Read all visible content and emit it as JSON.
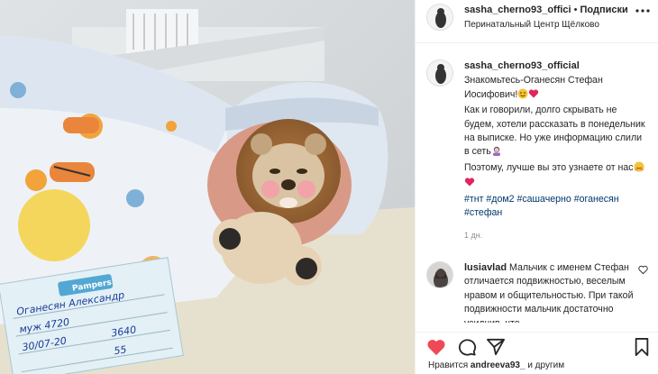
{
  "post": {
    "author": "sasha_cherno93_offici",
    "follow_label": "Подписки",
    "location": "Перинатальный Центр Щёлково",
    "separator": "•"
  },
  "caption": {
    "author": "sasha_cherno93_official",
    "line1": "Знакомьтесь-Оганесян Стефан Иосифович!",
    "line2": "Как и говорили, долго скрывать не будем, хотели рассказать в понедельник на выписке. Но уже информацию слили в сеть",
    "line3": "Поэтому, лучше вы это узнаете от нас",
    "hashtags": "#тнт #дом2 #сашачерно #оганесян #стефан",
    "timestamp": "1 дн."
  },
  "comment": {
    "author": "lusiavlad",
    "text": "Мальчик с именем Стефан отличается подвижностью, веселым нравом и общительностью. При такой подвижности мальчик достаточно усидчив, что"
  },
  "likes": {
    "prefix": "Нравится",
    "user": "andreeva93_",
    "suffix": "и другим"
  },
  "photo": {
    "card_lines": [
      "Pampers",
      "Оганесян Александр",
      "муж 4720",
      "30/07-20",
      "3640",
      "55"
    ]
  },
  "colors": {
    "like_red": "#ed4956",
    "hashtag_blue": "#00376b",
    "muted": "#8e8e8e",
    "border": "#efefef"
  },
  "icons": [
    "more-icon",
    "heart-icon",
    "comment-icon",
    "share-icon",
    "bookmark-icon"
  ]
}
